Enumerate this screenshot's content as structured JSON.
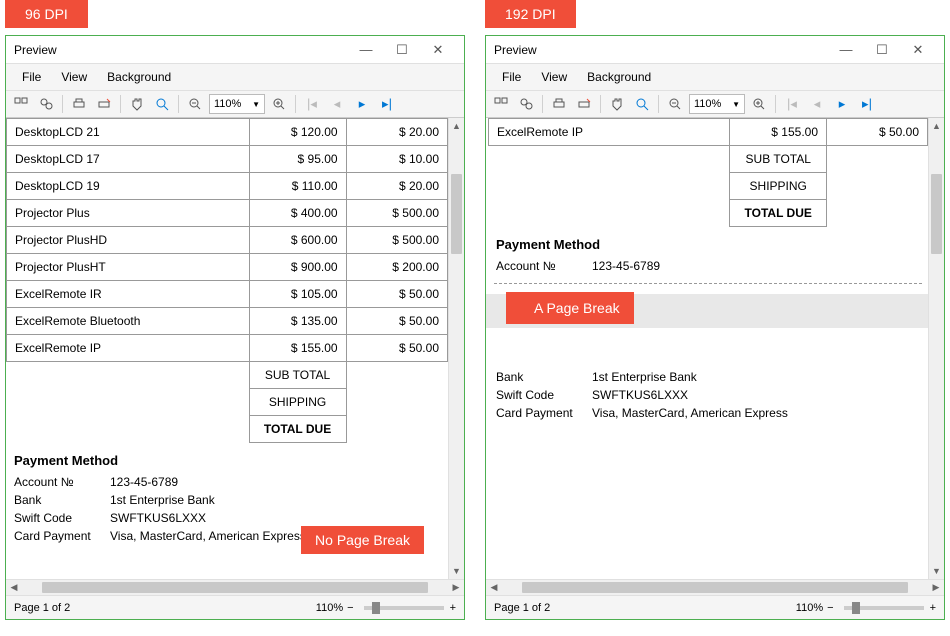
{
  "labels": {
    "dpi96": "96 DPI",
    "dpi192": "192 DPI",
    "no_break": "No Page Break",
    "a_break": "A Page Break",
    "title": "Preview",
    "file": "File",
    "view": "View",
    "background": "Background",
    "zoom_select": "110%",
    "subtotal": "SUB TOTAL",
    "shipping": "SHIPPING",
    "totaldue": "TOTAL DUE",
    "payment_method": "Payment Method",
    "account_k": "Account №",
    "account_v": "123-45-6789",
    "bank_k": "Bank",
    "bank_v": "1st Enterprise Bank",
    "swift_k": "Swift Code",
    "swift_v": "SWFTKUS6LXXX",
    "card_k": "Card Payment",
    "card_v": "Visa, MasterCard, American Express",
    "status_page": "Page 1 of 2",
    "status_zoom": "110%",
    "zoom_minus": "−",
    "zoom_plus": "+"
  },
  "left_rows": [
    {
      "n": "DesktopLCD 21",
      "a": "$ 120.00",
      "b": "$ 20.00"
    },
    {
      "n": "DesktopLCD 17",
      "a": "$ 95.00",
      "b": "$ 10.00"
    },
    {
      "n": "DesktopLCD 19",
      "a": "$ 110.00",
      "b": "$ 20.00"
    },
    {
      "n": "Projector Plus",
      "a": "$ 400.00",
      "b": "$ 500.00"
    },
    {
      "n": "Projector PlusHD",
      "a": "$ 600.00",
      "b": "$ 500.00"
    },
    {
      "n": "Projector PlusHT",
      "a": "$ 900.00",
      "b": "$ 200.00"
    },
    {
      "n": "ExcelRemote IR",
      "a": "$ 105.00",
      "b": "$ 50.00"
    },
    {
      "n": "ExcelRemote Bluetooth",
      "a": "$ 135.00",
      "b": "$ 50.00"
    },
    {
      "n": "ExcelRemote IP",
      "a": "$ 155.00",
      "b": "$ 50.00"
    }
  ],
  "right_rows": [
    {
      "n": "ExcelRemote IP",
      "a": "$ 155.00",
      "b": "$ 50.00"
    }
  ],
  "chart_data": {
    "type": "table",
    "columns": [
      "item",
      "col_a",
      "col_b"
    ],
    "data_96dpi": [
      [
        "DesktopLCD 21",
        120.0,
        20.0
      ],
      [
        "DesktopLCD 17",
        95.0,
        10.0
      ],
      [
        "DesktopLCD 19",
        110.0,
        20.0
      ],
      [
        "Projector Plus",
        400.0,
        500.0
      ],
      [
        "Projector PlusHD",
        600.0,
        500.0
      ],
      [
        "Projector PlusHT",
        900.0,
        200.0
      ],
      [
        "ExcelRemote IR",
        105.0,
        50.0
      ],
      [
        "ExcelRemote Bluetooth",
        135.0,
        50.0
      ],
      [
        "ExcelRemote IP",
        155.0,
        50.0
      ]
    ],
    "data_192dpi": [
      [
        "ExcelRemote IP",
        155.0,
        50.0
      ]
    ]
  }
}
